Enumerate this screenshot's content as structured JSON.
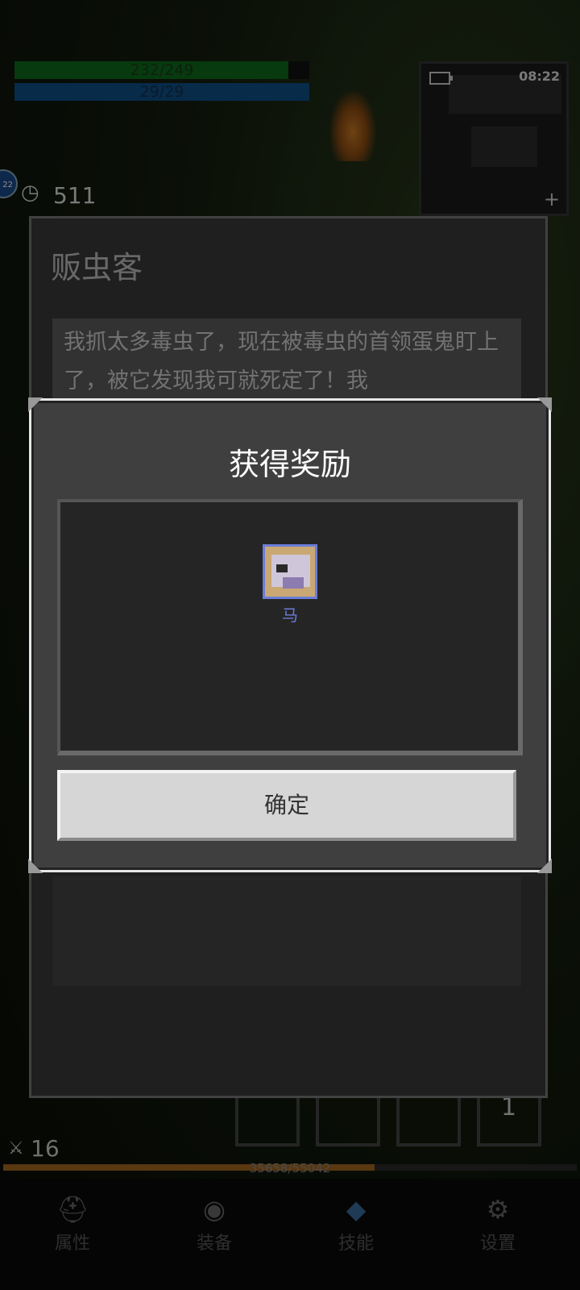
{
  "status": {
    "hp_text": "232/249",
    "hp_fraction": 0.93,
    "mp_text": "29/29",
    "mp_fraction": 1.0,
    "clock": "08:22",
    "timer_value": "511",
    "level_badge": "22",
    "attack_value": "16",
    "exp_text": "35658/55042",
    "exp_fraction": 0.648,
    "slot_count": "1"
  },
  "npc_dialog": {
    "name": "贩虫客",
    "text": "我抓太多毒虫了，现在被毒虫的首领蛋鬼盯上了，被它发现我可就死定了！我"
  },
  "reward_modal": {
    "title": "获得奖励",
    "item_name": "马",
    "confirm_label": "确定"
  },
  "bottom_nav": [
    {
      "label": "属性",
      "icon": "helmet-icon"
    },
    {
      "label": "装备",
      "icon": "bag-icon"
    },
    {
      "label": "技能",
      "icon": "gem-icon"
    },
    {
      "label": "设置",
      "icon": "gear-icon"
    }
  ]
}
